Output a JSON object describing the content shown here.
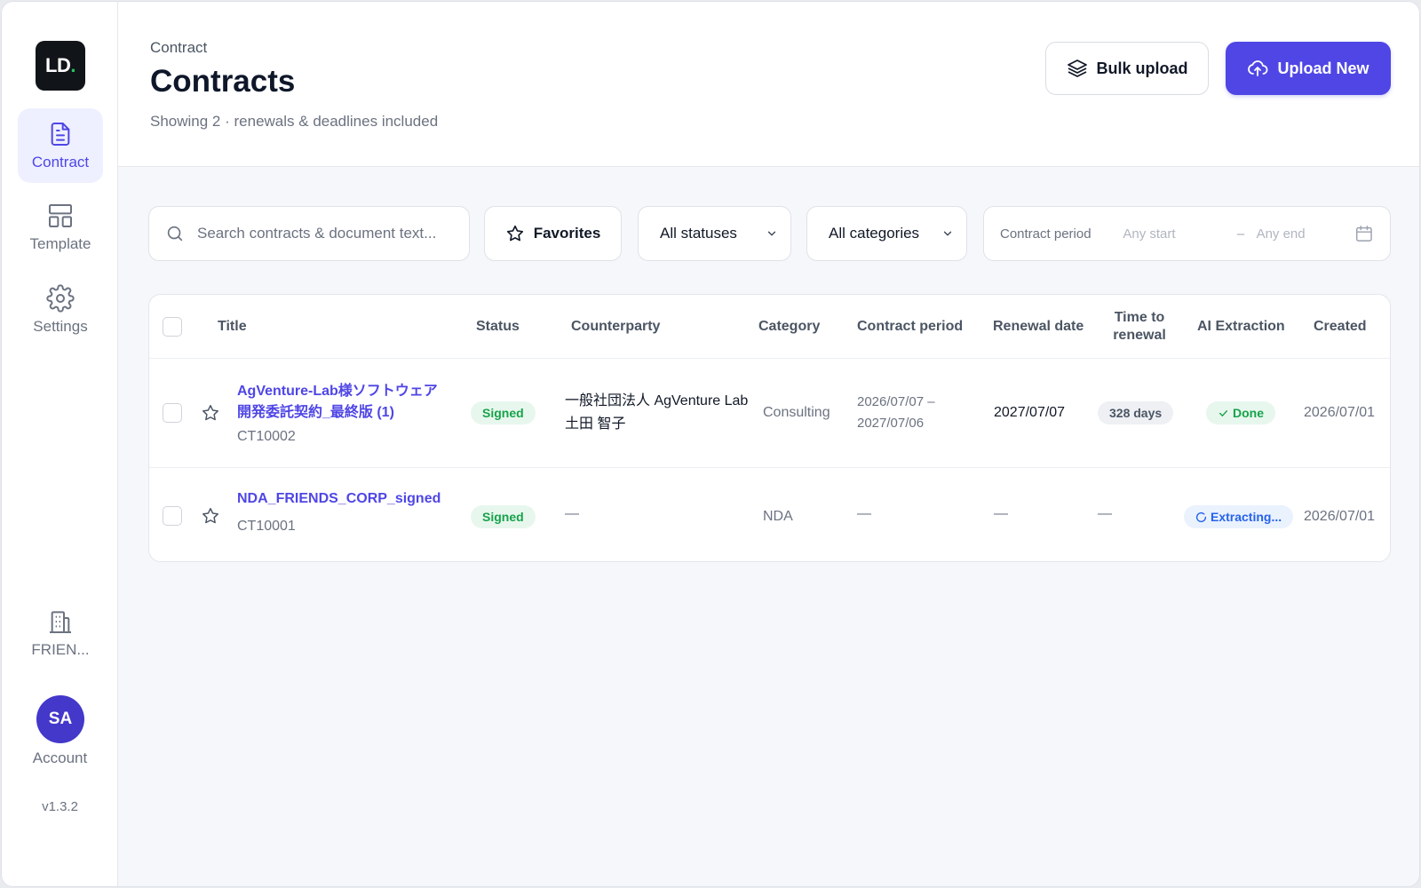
{
  "sidebar": {
    "logo_text": "LD",
    "logo_dot": ".",
    "items": [
      {
        "label": "Contract",
        "icon": "document-icon"
      },
      {
        "label": "Template",
        "icon": "layout-icon"
      },
      {
        "label": "Settings",
        "icon": "gear-icon"
      }
    ],
    "org_label": "FRIEN...",
    "avatar_initials": "SA",
    "account_label": "Account",
    "version": "v1.3.2"
  },
  "header": {
    "breadcrumb": "Contract",
    "title": "Contracts",
    "subtitle": "Showing 2 · renewals & deadlines included",
    "bulk_upload_label": "Bulk upload",
    "upload_new_label": "Upload New"
  },
  "filters": {
    "search_placeholder": "Search contracts & document text...",
    "favorites_label": "Favorites",
    "status_value": "All statuses",
    "category_value": "All categories",
    "period_label": "Contract period",
    "period_start_placeholder": "Any start",
    "period_dash": "–",
    "period_end_placeholder": "Any end"
  },
  "table": {
    "columns": [
      "Title",
      "Status",
      "Counterparty",
      "Category",
      "Contract period",
      "Renewal date",
      "Time to renewal",
      "AI Extraction",
      "Created"
    ],
    "time_to_renewal_line1": "Time to",
    "time_to_renewal_line2": "renewal",
    "rows": [
      {
        "title_line1": "AgVenture-Lab様ソフトウェア",
        "title_line2": "開発委託契約_最終版 (1)",
        "id": "CT10002",
        "status": "Signed",
        "counterparty_line1": "一般社団法人 AgVenture Lab",
        "counterparty_line2": "土田 智子",
        "category": "Consulting",
        "period_line1": "2026/07/07 –",
        "period_line2": "2027/07/06",
        "renewal_date": "2027/07/07",
        "time_to_renewal": "328 days",
        "ai_extraction": "Done",
        "created": "2026/07/01"
      },
      {
        "title_line1": "NDA_FRIENDS_CORP_signed",
        "id": "CT10001",
        "status": "Signed",
        "counterparty": "—",
        "category": "NDA",
        "period": "—",
        "renewal_date": "—",
        "time_to_renewal": "—",
        "ai_extraction": "Extracting...",
        "created": "2026/07/01"
      }
    ]
  },
  "colors": {
    "accent": "#4f46e5",
    "success": "#16a34a",
    "info": "#2563eb"
  }
}
